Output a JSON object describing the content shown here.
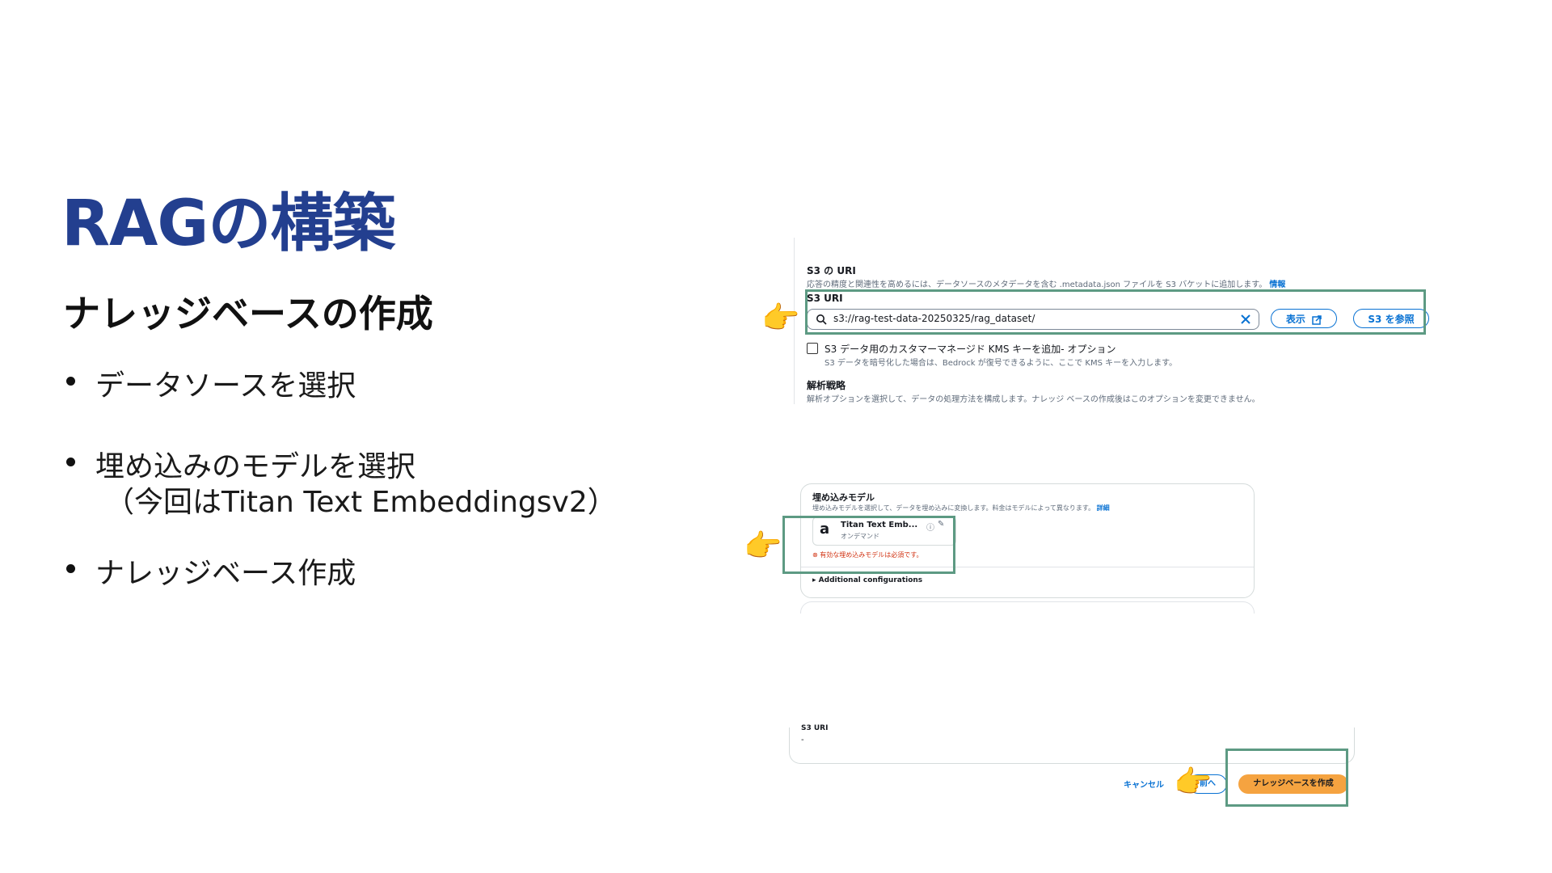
{
  "slide": {
    "title": "RAGの構築",
    "subtitle": "ナレッジベースの作成",
    "bullets": [
      {
        "text": "データソースを選択"
      },
      {
        "text": "埋め込みのモデルを選択",
        "sub": "（今回はTitan Text Embeddingsv2）"
      },
      {
        "text": "ナレッジベース作成"
      }
    ]
  },
  "screenshot1": {
    "section_label": "S3 の URI",
    "section_desc": "応答の精度と関連性を高めるには、データソースのメタデータを含む .metadata.json ファイルを S3 バケットに追加します。",
    "info_link": "情報",
    "field_label": "S3 URI",
    "uri_value": "s3://rag-test-data-20250325/rag_dataset/",
    "view_button": "表示",
    "browse_button": "S3 を参照",
    "kms_label": "S3 データ用のカスタマーマネージド KMS キーを追加- オプション",
    "kms_desc": "S3 データを暗号化した場合は、Bedrock が復号できるように、ここで KMS キーを入力します。",
    "parse_label": "解析戦略",
    "parse_desc": "解析オプションを選択して、データの処理方法を構成します。ナレッジ ベースの作成後はこのオプションを変更できません。"
  },
  "screenshot2": {
    "label": "埋め込みモデル",
    "desc": "埋め込みモデルを選択して、データを埋め込みに変換します。料金はモデルによって異なります。",
    "detail_link": "詳細",
    "model_name": "Titan Text Emb...",
    "model_sub": "オンデマンド",
    "error": "有効な埋め込みモデルは必須です。",
    "additional": "Additional configurations"
  },
  "screenshot3": {
    "partial_label": "S3 URI",
    "partial_value": "-",
    "cancel": "キャンセル",
    "back": "前へ",
    "create": "ナレッジベースを作成"
  }
}
